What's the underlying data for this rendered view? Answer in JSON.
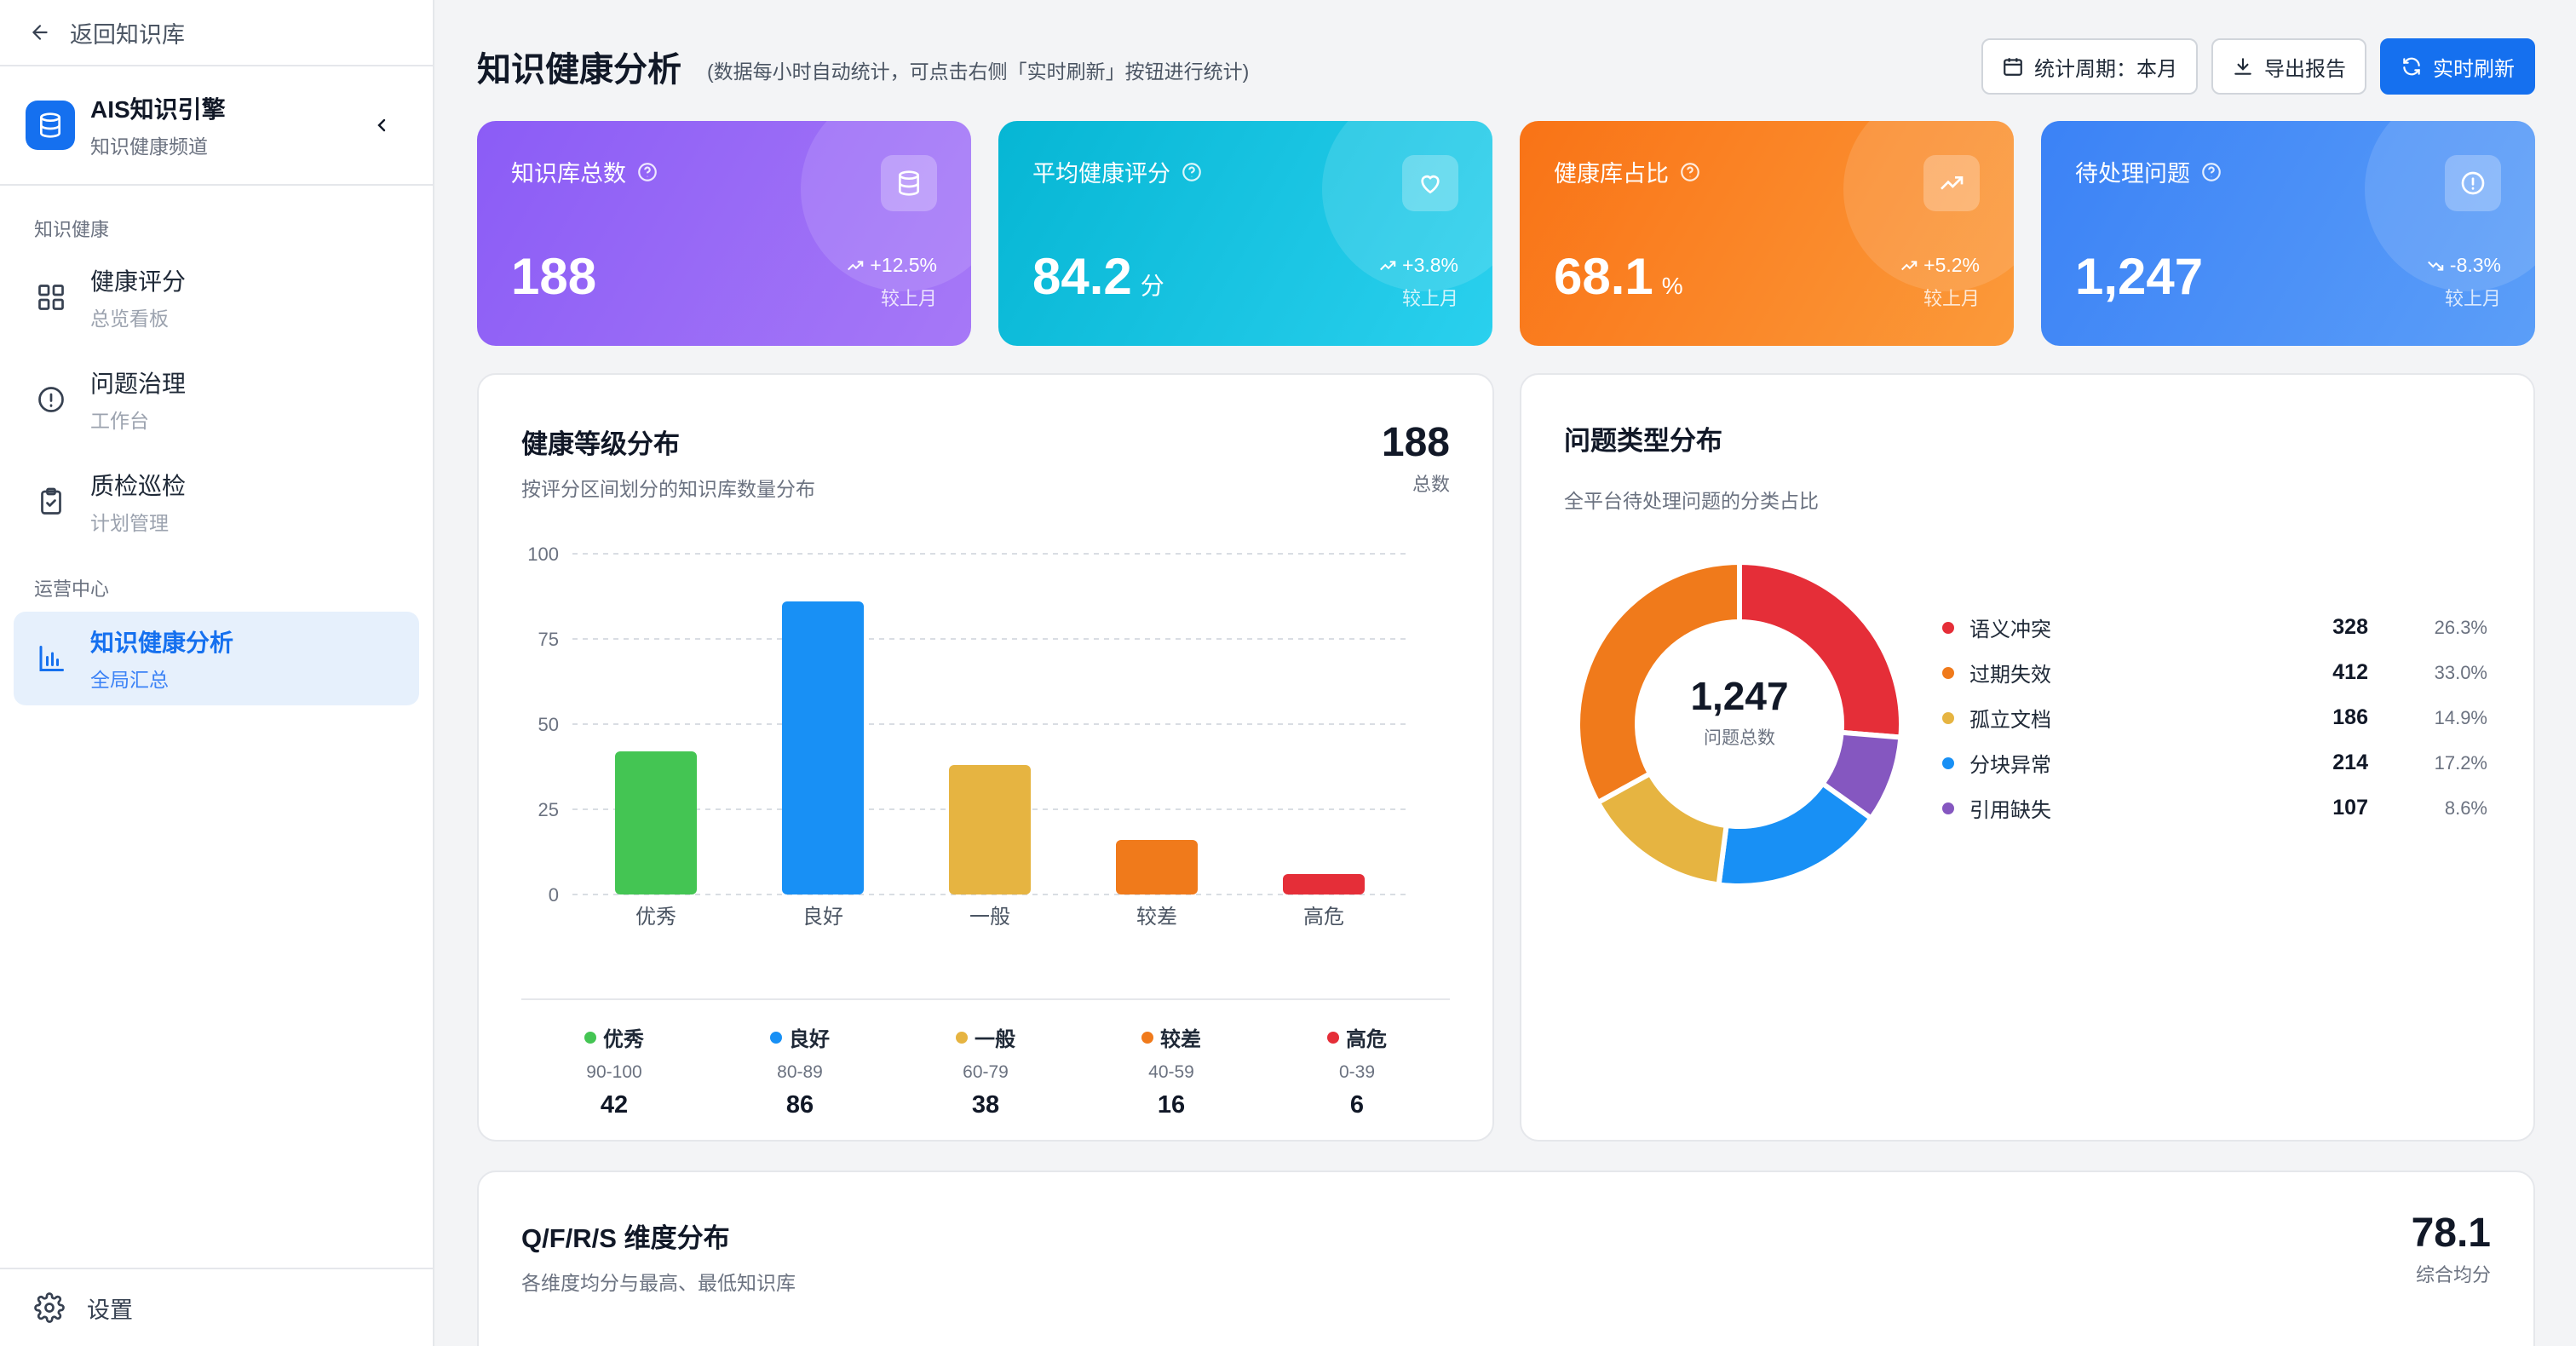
{
  "sidebar": {
    "back_label": "返回知识库",
    "app_name": "AIS知识引擎",
    "app_sub": "知识健康频道",
    "section1": "知识健康",
    "section2": "运营中心",
    "items": [
      {
        "title": "健康评分",
        "sub": "总览看板",
        "icon": "grid-icon"
      },
      {
        "title": "问题治理",
        "sub": "工作台",
        "icon": "alert-circle-icon"
      },
      {
        "title": "质检巡检",
        "sub": "计划管理",
        "icon": "clipboard-check-icon"
      },
      {
        "title": "知识健康分析",
        "sub": "全局汇总",
        "icon": "bar-chart-icon",
        "active": true
      }
    ],
    "settings_label": "设置"
  },
  "header": {
    "title": "知识健康分析",
    "note": "(数据每小时自动统计，可点击右侧「实时刷新」按钮进行统计)",
    "period_label": "统计周期：本月",
    "export_label": "导出报告",
    "refresh_label": "实时刷新"
  },
  "kpis": [
    {
      "label": "知识库总数",
      "value": "188",
      "unit": "",
      "delta": "+12.5%",
      "compare": "较上月",
      "trend": "up",
      "icon": "database-icon"
    },
    {
      "label": "平均健康评分",
      "value": "84.2",
      "unit": "分",
      "delta": "+3.8%",
      "compare": "较上月",
      "trend": "up",
      "icon": "heart-icon"
    },
    {
      "label": "健康库占比",
      "value": "68.1",
      "unit": "%",
      "delta": "+5.2%",
      "compare": "较上月",
      "trend": "up",
      "icon": "trending-up-icon"
    },
    {
      "label": "待处理问题",
      "value": "1,247",
      "unit": "",
      "delta": "-8.3%",
      "compare": "较上月",
      "trend": "down",
      "icon": "alert-circle-icon"
    }
  ],
  "health_card": {
    "title": "健康等级分布",
    "sub": "按评分区间划分的知识库数量分布",
    "total": "188",
    "total_label": "总数",
    "legend": [
      {
        "name": "优秀",
        "range": "90-100",
        "count": "42"
      },
      {
        "name": "良好",
        "range": "80-89",
        "count": "86"
      },
      {
        "name": "一般",
        "range": "60-79",
        "count": "38"
      },
      {
        "name": "较差",
        "range": "40-59",
        "count": "16"
      },
      {
        "name": "高危",
        "range": "0-39",
        "count": "6"
      }
    ]
  },
  "issue_card": {
    "title": "问题类型分布",
    "sub": "全平台待处理问题的分类占比",
    "center_value": "1,247",
    "center_label": "问题总数",
    "items": [
      {
        "name": "语义冲突",
        "count": "328",
        "pct": "26.3%"
      },
      {
        "name": "过期失效",
        "count": "412",
        "pct": "33.0%"
      },
      {
        "name": "孤立文档",
        "count": "186",
        "pct": "14.9%"
      },
      {
        "name": "分块异常",
        "count": "214",
        "pct": "17.2%"
      },
      {
        "name": "引用缺失",
        "count": "107",
        "pct": "8.6%"
      }
    ]
  },
  "dim_card": {
    "title": "Q/F/R/S 维度分布",
    "sub": "各维度均分与最高、最低知识库",
    "total": "78.1",
    "total_label": "综合均分"
  },
  "colors": {
    "excellent": "#44c553",
    "good": "#1890f5",
    "normal": "#e6b441",
    "poor": "#f07a1b",
    "danger": "#e52e38",
    "purple": "#8557c0",
    "accent": "#1570ef"
  },
  "chart_data": [
    {
      "type": "bar",
      "title": "健康等级分布",
      "categories": [
        "优秀",
        "良好",
        "一般",
        "较差",
        "高危"
      ],
      "values": [
        42,
        86,
        38,
        16,
        6
      ],
      "colors": [
        "#44c553",
        "#1890f5",
        "#e6b441",
        "#f07a1b",
        "#e52e38"
      ],
      "yticks": [
        0,
        25,
        50,
        75,
        100
      ],
      "ylim": [
        0,
        100
      ],
      "grid": true
    },
    {
      "type": "pie",
      "title": "问题类型分布",
      "categories": [
        "语义冲突",
        "过期失效",
        "孤立文档",
        "分块异常",
        "引用缺失"
      ],
      "values": [
        328,
        412,
        186,
        214,
        107
      ],
      "colors": [
        "#e52e38",
        "#f07a1b",
        "#e6b441",
        "#1890f5",
        "#8557c0"
      ],
      "order": [
        "语义冲突",
        "引用缺失",
        "分块异常",
        "孤立文档",
        "过期失效"
      ]
    }
  ]
}
